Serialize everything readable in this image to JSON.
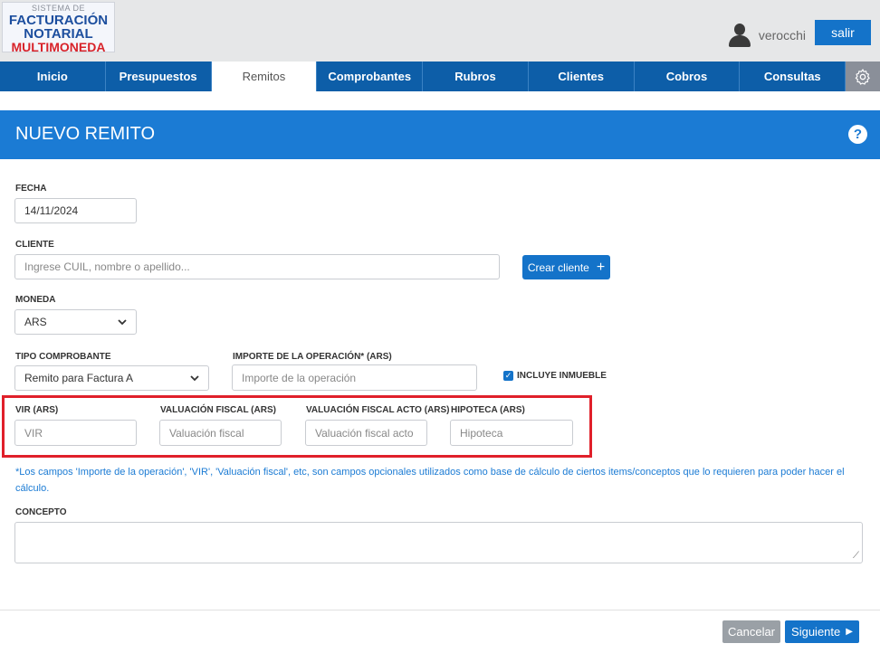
{
  "header": {
    "logo": {
      "line1": "SISTEMA DE",
      "line2": "FACTURACIÓN",
      "line3": "NOTARIAL",
      "line4": "MULTIMONEDA"
    },
    "user": {
      "name": "verocchi",
      "icon": "user-icon"
    },
    "logout_label": "salir"
  },
  "nav": {
    "tabs": [
      {
        "label": "Inicio"
      },
      {
        "label": "Presupuestos"
      },
      {
        "label": "Remitos"
      },
      {
        "label": "Comprobantes"
      },
      {
        "label": "Rubros"
      },
      {
        "label": "Clientes"
      },
      {
        "label": "Cobros"
      },
      {
        "label": "Consultas"
      }
    ],
    "active_tab": "Remitos",
    "settings_icon": "gear-icon"
  },
  "panel": {
    "title": "NUEVO REMITO",
    "help_icon": "question-circle-icon"
  },
  "form": {
    "fecha": {
      "label": "FECHA",
      "value": "14/11/2024"
    },
    "cliente": {
      "label": "CLIENTE",
      "placeholder": "Ingrese CUIL, nombre o apellido..."
    },
    "crear_cliente": {
      "label": "Crear cliente",
      "icon": "plus-icon"
    },
    "moneda": {
      "label": "MONEDA",
      "value": "ARS"
    },
    "tipo_comprobante": {
      "label": "TIPO COMPROBANTE",
      "value": "Remito para Factura A"
    },
    "importe": {
      "label": "IMPORTE DE LA OPERACIÓN* (ARS)",
      "placeholder": "Importe de la operación"
    },
    "incluye_inmueble": {
      "label": "INCLUYE INMUEBLE",
      "checked": true
    },
    "vir": {
      "label": "VIR (ARS)",
      "placeholder": "VIR"
    },
    "valuacion_fiscal": {
      "label": "VALUACIÓN FISCAL (ARS)",
      "placeholder": "Valuación fiscal"
    },
    "valuacion_fiscal_acto": {
      "label": "VALUACIÓN FISCAL ACTO (ARS)",
      "placeholder": "Valuación fiscal acto"
    },
    "hipoteca": {
      "label": "HIPOTECA (ARS)",
      "placeholder": "Hipoteca"
    },
    "note": "*Los campos 'Importe de la operación', 'VIR', 'Valuación fiscal', etc, son campos opcionales utilizados como base de cálculo de ciertos items/conceptos que lo requieren para poder hacer el cálculo.",
    "concepto": {
      "label": "CONCEPTO",
      "value": ""
    }
  },
  "footer": {
    "cancel_label": "Cancelar",
    "next_label": "Siguiente"
  },
  "colors": {
    "primary": "#1473c9",
    "nav": "#0d5ea8",
    "panel_header": "#1b7bd4",
    "highlight_border": "#e0202a",
    "cancel": "#9aa0a6"
  }
}
